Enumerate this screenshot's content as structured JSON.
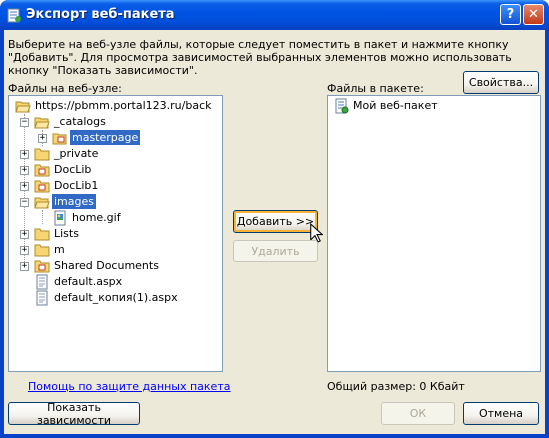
{
  "window": {
    "title": "Экспорт веб-пакета",
    "help_button": "?",
    "close_button": "✕"
  },
  "intro_text": "Выберите на веб-узле файлы, которые следует поместить в пакет и нажмите кнопку \"Добавить\". Для просмотра зависимостей выбранных элементов можно использовать кнопку \"Показать зависимости\".",
  "left_label": "Файлы на веб-узле:",
  "right_label": "Файлы в пакете:",
  "properties_button": "Свойства...",
  "tree": {
    "root": "https://pbmm.portal123.ru/back",
    "items": [
      {
        "label": "_catalogs",
        "expander": "−",
        "icon": "folder-open-icon"
      },
      {
        "label": "masterpage",
        "expander": "+",
        "icon": "site-folder-icon",
        "selected": true
      },
      {
        "label": "_private",
        "expander": "+",
        "icon": "folder-icon"
      },
      {
        "label": "DocLib",
        "expander": "+",
        "icon": "document-library-icon"
      },
      {
        "label": "DocLib1",
        "expander": "+",
        "icon": "document-library-icon"
      },
      {
        "label": "images",
        "expander": "−",
        "icon": "folder-open-icon",
        "selected": true
      },
      {
        "label": "home.gif",
        "icon": "image-file-icon"
      },
      {
        "label": "Lists",
        "expander": "+",
        "icon": "folder-icon"
      },
      {
        "label": "m",
        "expander": "+",
        "icon": "folder-icon"
      },
      {
        "label": "Shared Documents",
        "expander": "+",
        "icon": "document-library-icon"
      },
      {
        "label": "default.aspx",
        "icon": "page-file-icon"
      },
      {
        "label": "default_копия(1).aspx",
        "icon": "page-file-icon"
      }
    ]
  },
  "package": {
    "items": [
      {
        "label": "Мой веб-пакет",
        "icon": "web-package-icon"
      }
    ]
  },
  "add_button": "Добавить >>",
  "remove_button": "Удалить",
  "help_link": "Помощь по защите данных пакета",
  "total_size": "Общий размер: 0 Кбайт",
  "show_dependencies_button": "Показать зависимости",
  "ok_button": "ОК",
  "cancel_button": "Отмена",
  "colors": {
    "titlebar": "#0054e3",
    "client": "#ece9d8",
    "selection": "#316ac5",
    "link": "#0000ff"
  }
}
